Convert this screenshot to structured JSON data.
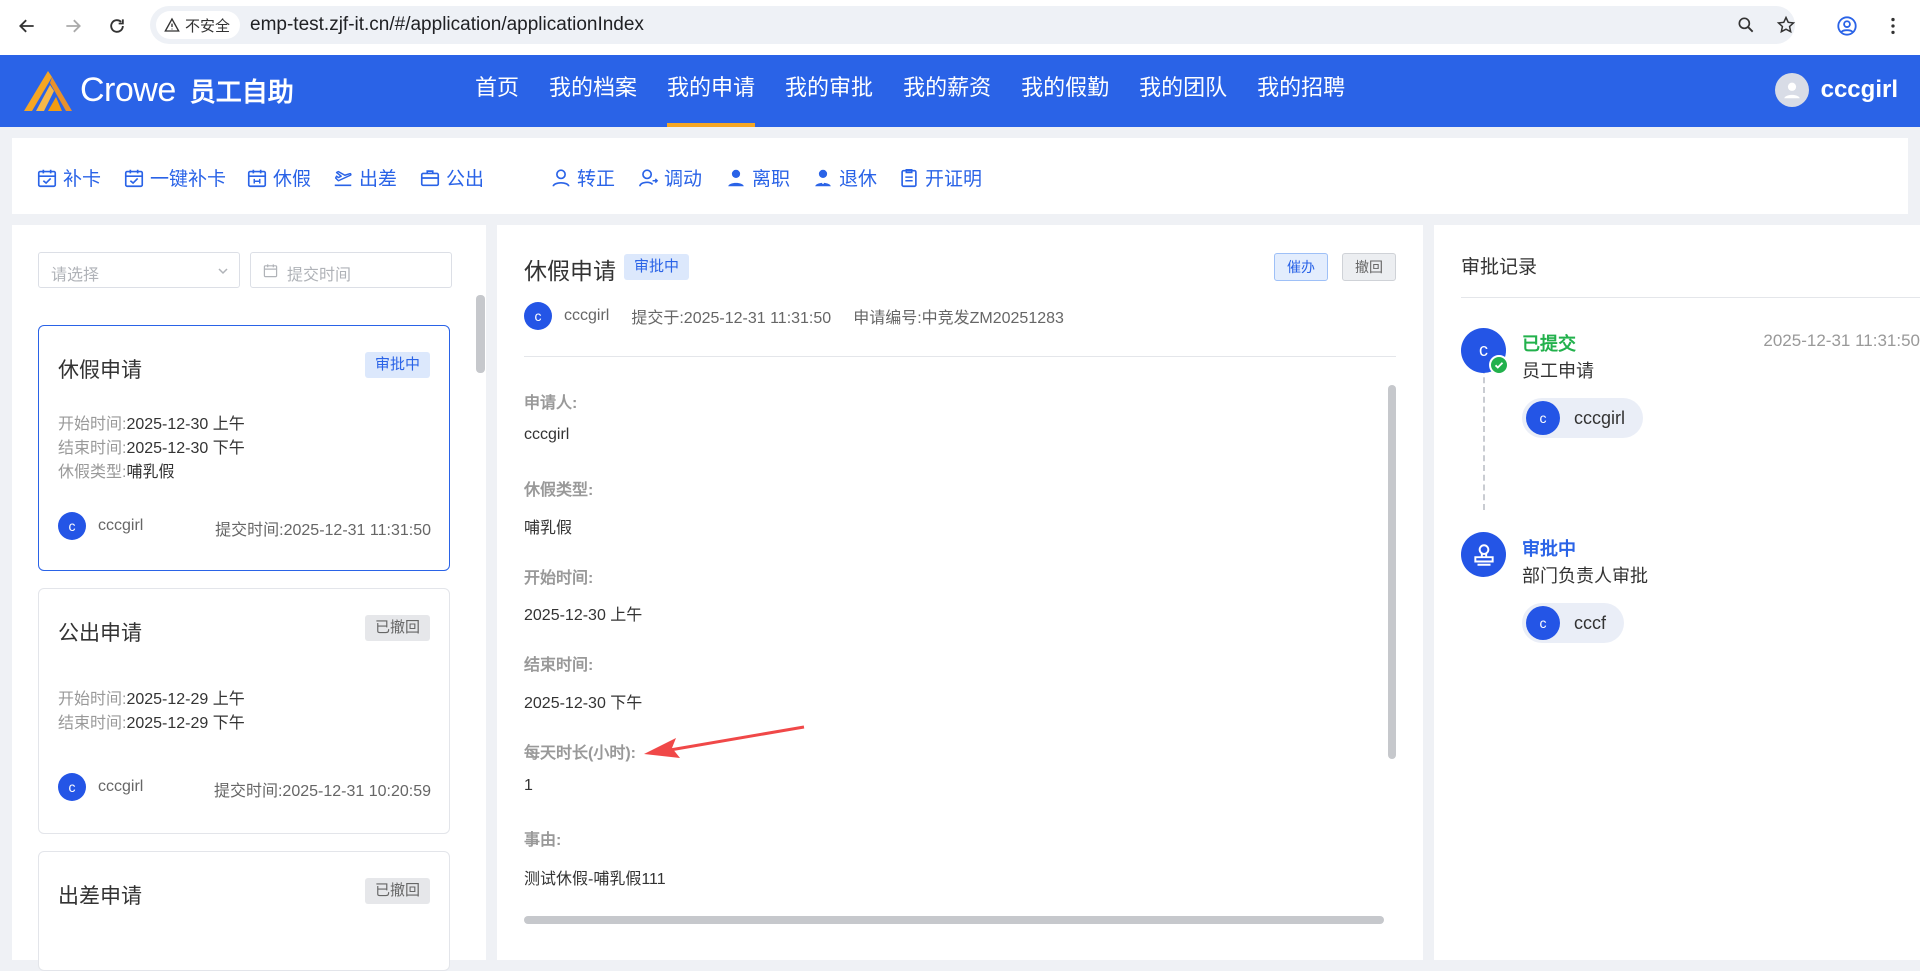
{
  "browser": {
    "security_label": "不安全",
    "url": "emp-test.zjf-it.cn/#/application/applicationIndex"
  },
  "header": {
    "brand": "Crowe",
    "app_name": "员工自助",
    "nav": [
      "首页",
      "我的档案",
      "我的申请",
      "我的审批",
      "我的薪资",
      "我的假勤",
      "我的团队",
      "我的招聘"
    ],
    "active_nav": "我的申请",
    "user": "cccgirl"
  },
  "toolbar": {
    "items": [
      {
        "label": "补卡",
        "icon": "calendar-check-icon"
      },
      {
        "label": "一键补卡",
        "icon": "calendar-check-icon"
      },
      {
        "label": "休假",
        "icon": "calendar-leave-icon"
      },
      {
        "label": "出差",
        "icon": "plane-icon"
      },
      {
        "label": "公出",
        "icon": "briefcase-icon"
      },
      {
        "label": "转正",
        "icon": "user-icon"
      },
      {
        "label": "调动",
        "icon": "user-transfer-icon"
      },
      {
        "label": "离职",
        "icon": "user-leave-icon"
      },
      {
        "label": "退休",
        "icon": "user-retire-icon"
      },
      {
        "label": "开证明",
        "icon": "document-icon"
      }
    ]
  },
  "filters": {
    "status_placeholder": "请选择",
    "date_placeholder": "提交时间"
  },
  "list": {
    "submit_label": "提交时间:",
    "cards": [
      {
        "title": "休假申请",
        "status": "审批中",
        "fields": [
          {
            "k": "开始时间:",
            "v": "2025-12-30 上午"
          },
          {
            "k": "结束时间:",
            "v": "2025-12-30 下午"
          },
          {
            "k": "休假类型:",
            "v": "哺乳假"
          }
        ],
        "user_initial": "c",
        "user": "cccgirl",
        "submit_time": "2025-12-31 11:31:50"
      },
      {
        "title": "公出申请",
        "status": "已撤回",
        "fields": [
          {
            "k": "开始时间:",
            "v": "2025-12-29 上午"
          },
          {
            "k": "结束时间:",
            "v": "2025-12-29 下午"
          }
        ],
        "user_initial": "c",
        "user": "cccgirl",
        "submit_time": "2025-12-31 10:20:59"
      },
      {
        "title": "出差申请",
        "status": "已撤回"
      }
    ]
  },
  "detail": {
    "title": "休假申请",
    "status": "审批中",
    "urge_label": "催办",
    "revoke_label": "撤回",
    "user_initial": "c",
    "user": "cccgirl",
    "submitted": "提交于:2025-12-31 11:31:50",
    "app_no": "申请编号:中竞发ZM20251283",
    "fields": [
      {
        "label": "申请人:",
        "value": "cccgirl"
      },
      {
        "label": "休假类型:",
        "value": "哺乳假"
      },
      {
        "label": "开始时间:",
        "value": "2025-12-30 上午"
      },
      {
        "label": "结束时间:",
        "value": "2025-12-30 下午"
      },
      {
        "label": "每天时长(小时):",
        "value": "1"
      },
      {
        "label": "事由:",
        "value": "测试休假-哺乳假111"
      }
    ]
  },
  "records": {
    "title": "审批记录",
    "steps": [
      {
        "status": "已提交",
        "node": "员工申请",
        "time": "2025-12-31 11:31:50",
        "initial": "c",
        "approver": "cccgirl"
      },
      {
        "status": "审批中",
        "node": "部门负责人审批",
        "initial": "c",
        "approver": "cccf"
      }
    ]
  },
  "colors": {
    "primary": "#2a63e7",
    "accent": "#f5a623",
    "success": "#22b14c",
    "annotation_arrow": "#f04848"
  }
}
